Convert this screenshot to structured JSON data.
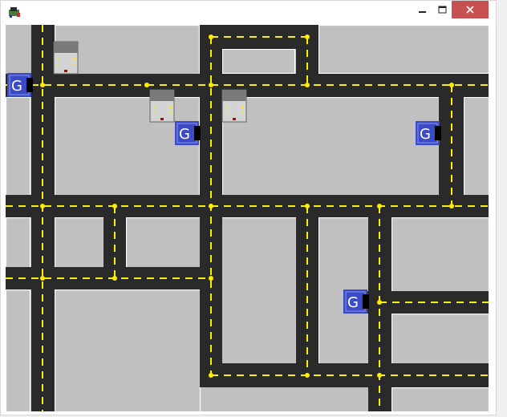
{
  "window": {
    "app_icon": "game-app-icon",
    "controls": {
      "minimize_icon": "minimize-icon",
      "maximize_icon": "maximize-icon",
      "close_icon": "close-icon",
      "close_color": "#c75050"
    }
  },
  "board": {
    "colors": {
      "background": "#c0c0c0",
      "road": "#2a2a2a",
      "lane_marking": "#ffee00",
      "intersection_dot": "#ffee00",
      "garage": "#3b4bc8",
      "garage_door": "#000000",
      "car_roof": "#7a7a7a",
      "car_body": "#d4d4d4",
      "car_headlight": "#ffee00",
      "car_taillight": "#c00000"
    },
    "garage_label": "G",
    "garage_count": 4,
    "car_count": 3
  }
}
